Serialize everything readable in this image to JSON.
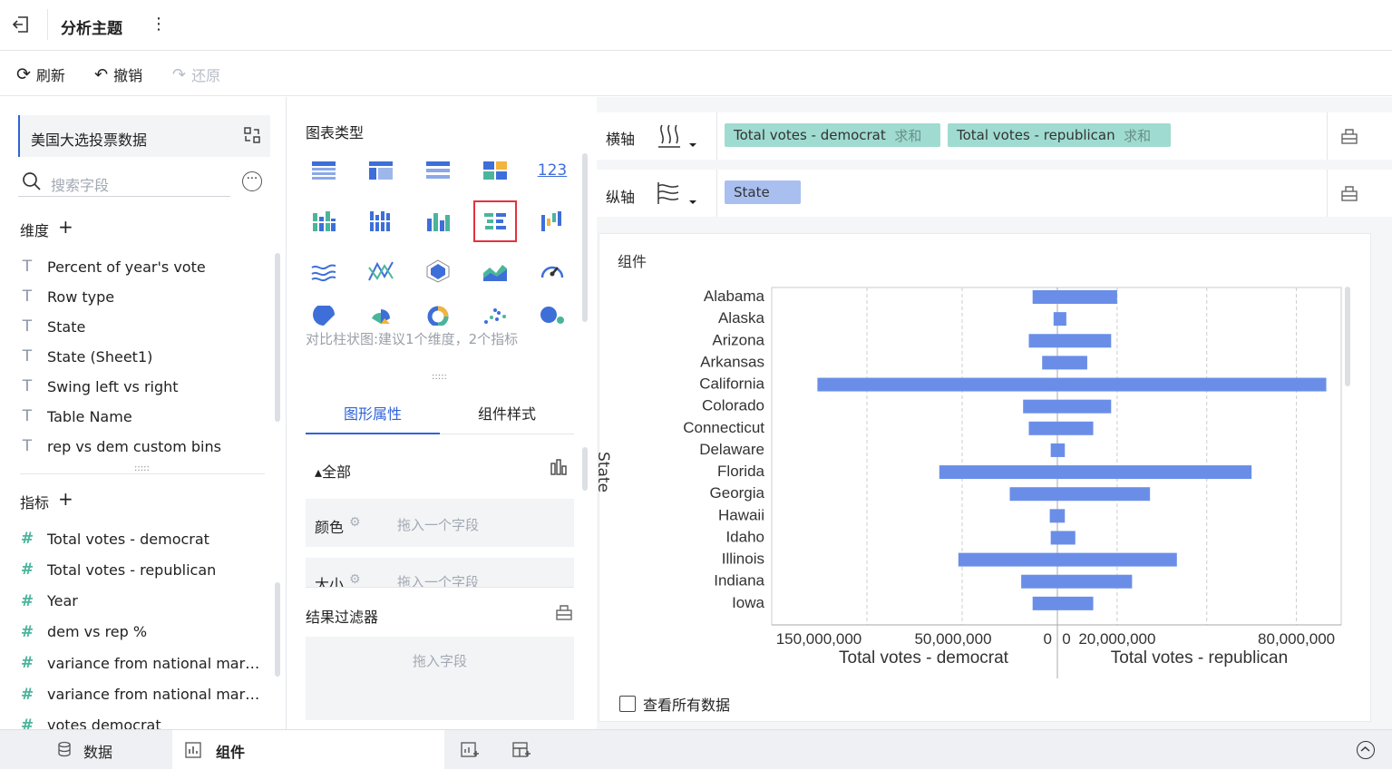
{
  "topbar": {
    "title": "分析主题",
    "more": "⋮"
  },
  "toolbar": {
    "refresh": "刷新",
    "undo": "撤销",
    "redo": "还原"
  },
  "dataset": {
    "name": "美国大选投票数据",
    "search_placeholder": "搜索字段"
  },
  "dimensions": {
    "label": "维度",
    "items": [
      "Percent of year's vote",
      "Row type",
      "State",
      "State (Sheet1)",
      "Swing left vs right",
      "Table Name",
      "rep vs dem custom bins"
    ]
  },
  "measures": {
    "label": "指标",
    "items": [
      "Total votes - democrat",
      "Total votes - republican",
      "Year",
      "dem vs rep %",
      "variance from national mar…",
      "variance from national mar…",
      "votes democrat"
    ]
  },
  "chart_types": {
    "label": "图表类型",
    "hint": "对比柱状图:建议1个维度，2个指标",
    "number_icon": "123"
  },
  "props": {
    "tab_graph": "图形属性",
    "tab_style": "组件样式",
    "all": "全部",
    "color_label": "颜色",
    "size_label": "大小",
    "drop_one": "拖入一个字段",
    "drop_one_size": "拖入一个字段",
    "filter_label": "结果过滤器",
    "filter_drop": "拖入字段"
  },
  "axes": {
    "x_label": "横轴",
    "y_label": "纵轴",
    "x_fields": [
      {
        "name": "Total votes - democrat",
        "agg": "求和"
      },
      {
        "name": "Total votes - republican",
        "agg": "求和"
      }
    ],
    "y_fields": [
      {
        "name": "State"
      }
    ]
  },
  "widget": {
    "title": "组件",
    "show_all": "查看所有数据"
  },
  "chart_data": {
    "type": "bar",
    "orientation": "horizontal-butterfly",
    "ylabel": "State",
    "categories": [
      "Alabama",
      "Alaska",
      "Arizona",
      "Arkansas",
      "California",
      "Colorado",
      "Connecticut",
      "Delaware",
      "Florida",
      "Georgia",
      "Hawaii",
      "Idaho",
      "Illinois",
      "Indiana",
      "Iowa"
    ],
    "series": [
      {
        "name": "Total votes - democrat",
        "values": [
          13000000,
          2000000,
          15000000,
          8000000,
          126000000,
          18000000,
          15000000,
          3500000,
          62000000,
          25000000,
          4000000,
          3500000,
          52000000,
          19000000,
          13000000
        ]
      },
      {
        "name": "Total votes - republican",
        "values": [
          20000000,
          3000000,
          18000000,
          10000000,
          90000000,
          18000000,
          12000000,
          2500000,
          65000000,
          31000000,
          2500000,
          6000000,
          40000000,
          25000000,
          12000000
        ]
      }
    ],
    "left_axis": {
      "label": "Total votes - democrat",
      "ticks": [
        "150,000,000",
        "50,000,000",
        "0"
      ],
      "range": [
        0,
        150000000
      ]
    },
    "right_axis": {
      "label": "Total votes - republican",
      "ticks": [
        "0",
        "20,000,000",
        "80,000,000"
      ],
      "range": [
        0,
        95000000
      ]
    }
  },
  "bottom": {
    "tab_data": "数据",
    "tab_component": "组件"
  },
  "colors": {
    "accent": "#2f63d9",
    "bar": "#6a8ee8",
    "pill_x": "#9fdbd1",
    "pill_y": "#a9bff0",
    "highlight": "#e3323c"
  }
}
